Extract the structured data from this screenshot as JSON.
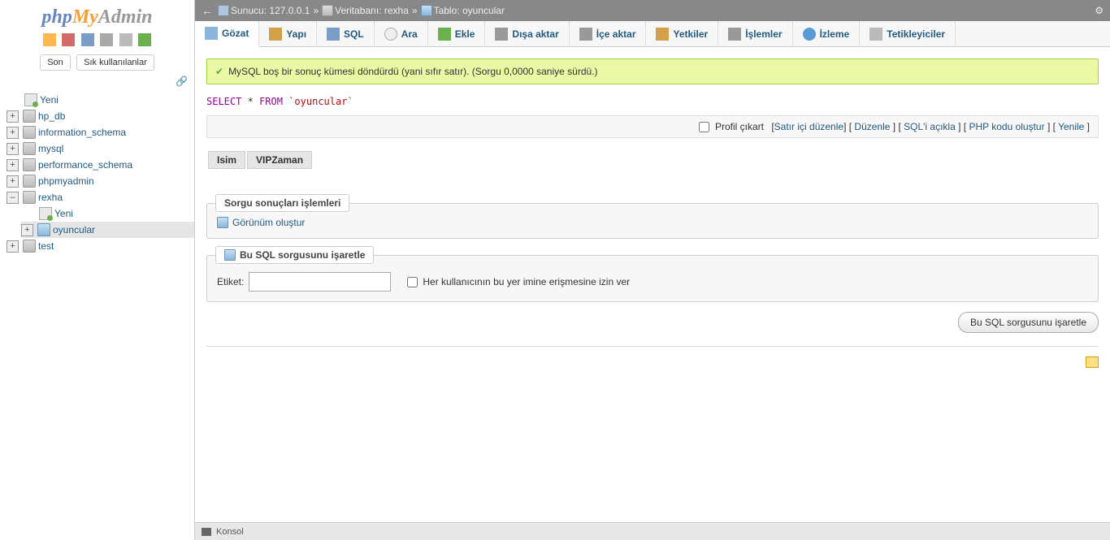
{
  "logo": {
    "p1": "php",
    "p2": "My",
    "p3": "Admin"
  },
  "sidebar": {
    "recent": "Son",
    "favorites": "Sık kullanılanlar",
    "new": "Yeni",
    "databases": [
      {
        "name": "hp_db"
      },
      {
        "name": "information_schema"
      },
      {
        "name": "mysql"
      },
      {
        "name": "performance_schema"
      },
      {
        "name": "phpmyadmin"
      },
      {
        "name": "rexha",
        "expanded": true,
        "children": [
          {
            "name": "Yeni",
            "type": "new"
          },
          {
            "name": "oyuncular",
            "type": "table",
            "selected": true
          }
        ]
      },
      {
        "name": "test"
      }
    ]
  },
  "breadcrumb": {
    "server_label": "Sunucu:",
    "server": "127.0.0.1",
    "db_label": "Veritabanı:",
    "db": "rexha",
    "table_label": "Tablo:",
    "table": "oyuncular"
  },
  "tabs": [
    {
      "label": "Gözat",
      "icon": "ic-browse",
      "active": true
    },
    {
      "label": "Yapı",
      "icon": "ic-struct"
    },
    {
      "label": "SQL",
      "icon": "ic-sqltab"
    },
    {
      "label": "Ara",
      "icon": "ic-search"
    },
    {
      "label": "Ekle",
      "icon": "ic-insert"
    },
    {
      "label": "Dışa aktar",
      "icon": "ic-export"
    },
    {
      "label": "İçe aktar",
      "icon": "ic-import"
    },
    {
      "label": "Yetkiler",
      "icon": "ic-priv"
    },
    {
      "label": "İşlemler",
      "icon": "ic-ops"
    },
    {
      "label": "İzleme",
      "icon": "ic-track"
    },
    {
      "label": "Tetikleyiciler",
      "icon": "ic-trigger"
    }
  ],
  "message": "MySQL boş bir sonuç kümesi döndürdü (yani sıfır satır). (Sorgu 0,0000 saniye sürdü.)",
  "sql": {
    "select": "SELECT",
    "star": "*",
    "from": "FROM",
    "table": "`oyuncular`"
  },
  "actions": {
    "profile": "Profil çıkart",
    "inline_edit": "Satır içi düzenle",
    "edit": "Düzenle",
    "explain": "SQL'i açıkla",
    "php": "PHP kodu oluştur",
    "refresh": "Yenile"
  },
  "columns": [
    "Isim",
    "VIPZaman"
  ],
  "query_ops": {
    "legend": "Sorgu sonuçları işlemleri",
    "create_view": "Görünüm oluştur"
  },
  "bookmark": {
    "legend": "Bu SQL sorgusunu işaretle",
    "label": "Etiket:",
    "allow_all": "Her kullanıcının bu yer imine erişmesine izin ver",
    "button": "Bu SQL sorgusunu işaretle"
  },
  "console": "Konsol"
}
